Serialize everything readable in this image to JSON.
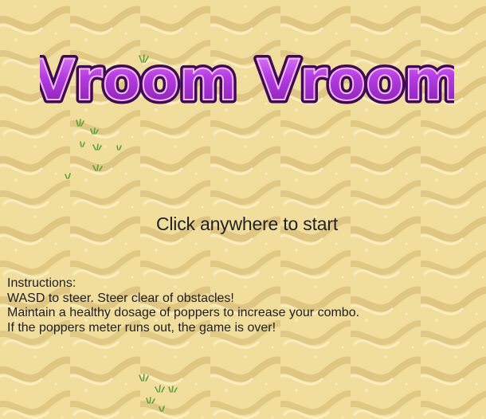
{
  "game": {
    "title": "Vroom Vroom",
    "start_prompt": "Click anywhere to start"
  },
  "instructions": {
    "heading": "Instructions:",
    "lines": [
      "WASD to steer. Steer clear of obstacles!",
      "Maintain a healthy dosage of poppers to increase your combo.",
      "If the poppers meter runs out, the game is over!"
    ]
  },
  "colors": {
    "sand": "#f1de9c",
    "sand_shadow": "#d9c07a",
    "sand_highlight": "#fbf0c4",
    "title_fill": "#b43be3",
    "title_outline": "#5e0f78",
    "grass": "#5f9e3e"
  }
}
